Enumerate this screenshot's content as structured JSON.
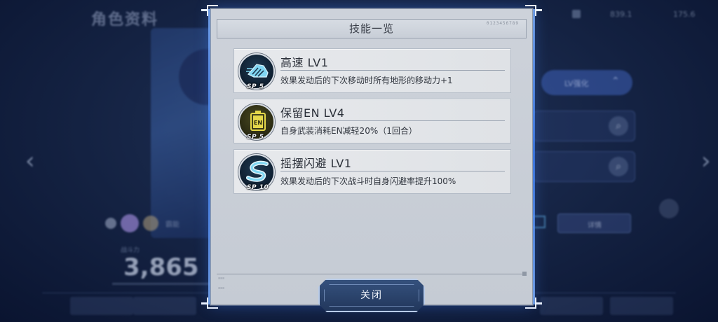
{
  "background": {
    "screen_title": "角色资料",
    "resources": [
      "839.1",
      "175.6"
    ],
    "lv_button_label": "LV强化",
    "detail_button_label": "详情",
    "unit_rank_label": "霸能",
    "power_label": "战斗力",
    "combat_power": "3,865"
  },
  "modal": {
    "title": "技能一览",
    "header_code": "0123456789",
    "close_label": "关闭",
    "skills": [
      {
        "name": "高速 LV1",
        "sp": "SP 5",
        "icon": "boot-dash-icon",
        "description": "效果发动后的下次移动时所有地形的移动力+1"
      },
      {
        "name": "保留EN LV4",
        "sp": "SP 5",
        "icon": "en-battery-icon",
        "description": "自身武装消耗EN减轻20%（1回合）"
      },
      {
        "name": "摇摆闪避 LV1",
        "sp": "SP 10",
        "icon": "s-swerve-icon",
        "description": "效果发动后的下次战斗时自身闪避率提升100%"
      }
    ]
  },
  "colors": {
    "panel": "#c8ced7",
    "card": "#e4e6e9",
    "accent_glow": "#3d7df0",
    "icon_bg_cyan": "#0f1f30",
    "icon_accent_cyan": "#7fd6f2",
    "icon_accent_yellow": "#e5d84a",
    "close_button": "#2b4268"
  }
}
